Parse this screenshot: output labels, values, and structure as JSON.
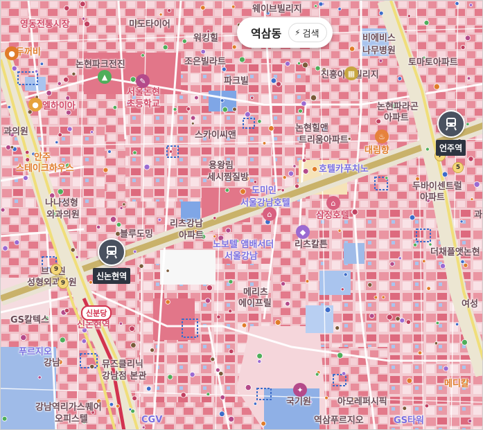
{
  "search": {
    "location": "역삼동",
    "button_label": "검색"
  },
  "stations": [
    {
      "name": "신논현역"
    },
    {
      "name": "언주역"
    }
  ],
  "line_badge": "신분당",
  "line_numbers": [
    "9",
    "9",
    "7",
    "5"
  ],
  "labels": {
    "l1": "영동전통시장",
    "l2": "미도타이어",
    "l3": "웨이브빌리지",
    "l4": "워킹힐",
    "l5": "비에비스",
    "l6": "나무병원",
    "l7": "두꺼비",
    "l8": "논현파크전진",
    "l9": "조은빌라트",
    "l10": "토마토아파트",
    "l11": "서울논현",
    "l12": "초등학교",
    "l13": "파크빌",
    "l14": "진흥아트빌리지",
    "l15": "스카이씨앤",
    "l16": "논현파라곤",
    "l17": "아파트",
    "l18": "과의원",
    "l19": "엘하이아",
    "l20": "논현힐앤",
    "l21": "트리움아파트",
    "l22": "안주",
    "l23": "스테이크하우스",
    "l24": "용왕림",
    "l25": "세시찜질방",
    "l26": "대림향",
    "l27": "호텔카푸치노",
    "l28": "두바이센트럴",
    "l29": "아파트",
    "l30": "나나성형",
    "l31": "외과의원",
    "l32": "도미인",
    "l33": "서울강남호텔",
    "l34": "삼정호텔",
    "l35": "리츠칼튼",
    "l36": "블루도밍",
    "l37": "리츠강남",
    "l38": "아파트",
    "l39": "노보텔 앰배서더",
    "l40": "서울강남",
    "l41": "더채플앳논현",
    "l42": "브이원",
    "l43": "성형외과의원",
    "l44": "메리츠",
    "l45": "에이프릴",
    "l46": "여성",
    "l47": "GS칼텍스",
    "l48": "신논현역",
    "l49": "푸르지오",
    "l50": "강남",
    "l51": "뮤즈클리닉",
    "l52": "강남점 본관",
    "l53": "국기원",
    "l54": "아모레퍼시픽",
    "l55": "강남역리가스퀘어",
    "l56": "오피스텔",
    "l57": "CGV",
    "l58": "역삼푸르지오",
    "l59": "GS타워",
    "l60": "메디칼",
    "l61": "과"
  }
}
